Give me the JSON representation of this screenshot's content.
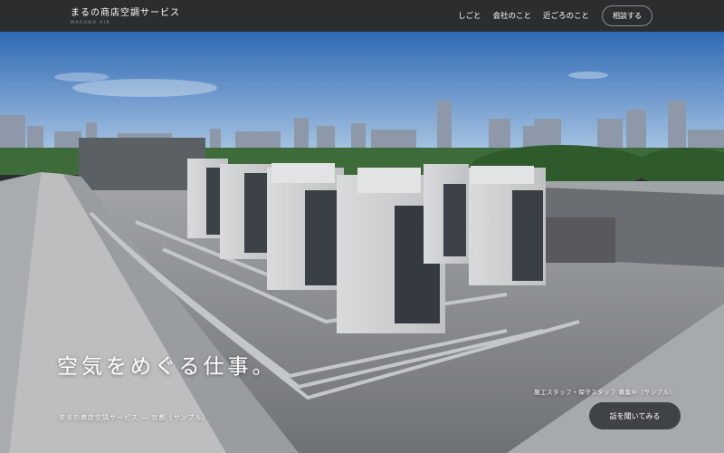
{
  "header": {
    "brand_name": "まるの商店空調サービス",
    "brand_sub": "MARUNO AIR",
    "nav": [
      "しごと",
      "会社のこと",
      "近ごろのこと"
    ],
    "cta_label": "相談する"
  },
  "hero": {
    "headline": "空気をめぐる仕事。",
    "caption": "まるの商店空調サービス — 京都（サンプル）",
    "staff_notice": "施工スタッフ・保守スタッフ 募集中（サンプル）",
    "listen_button": "話を聞いてみる"
  },
  "colors": {
    "header_bg": "#2c2d2f",
    "button_bg": "#404346",
    "sky": "#4f86c9",
    "roof": "#8c8f92"
  }
}
